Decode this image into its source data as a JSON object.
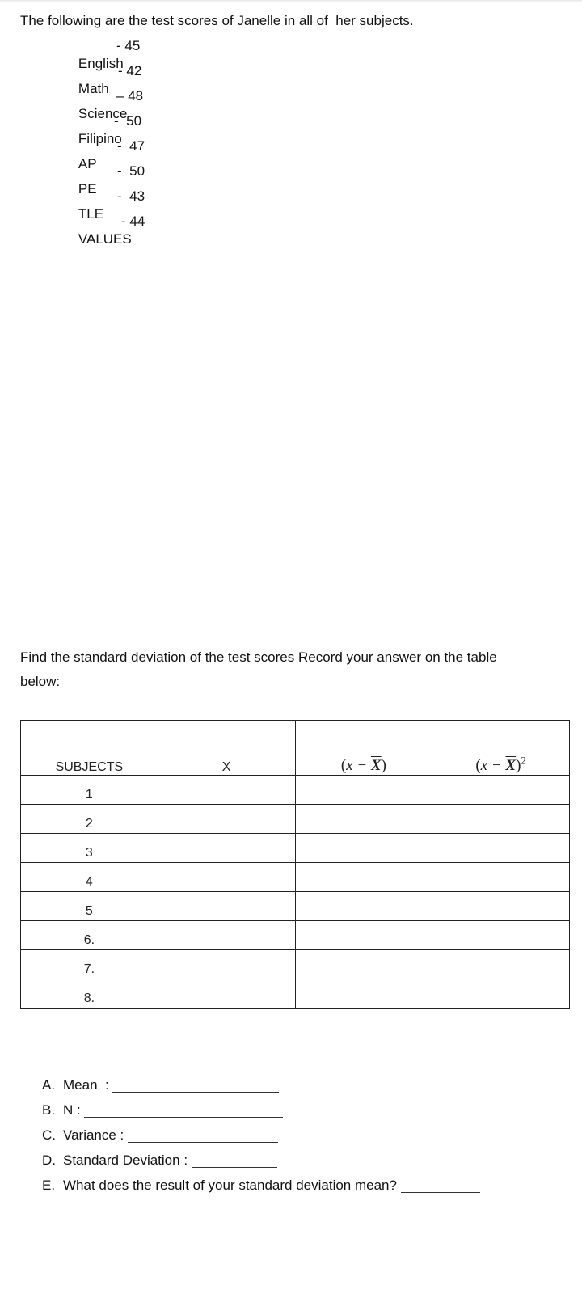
{
  "intro": "The following are the test scores of Janelle in all of  her subjects.",
  "scores": [
    {
      "subject": "English",
      "sep": "-",
      "score": "45"
    },
    {
      "subject": "Math",
      "sep": "-",
      "score": "42"
    },
    {
      "subject": "Science",
      "sep": "–",
      "score": "48"
    },
    {
      "subject": "Filipino",
      "sep": "-",
      "score": "50"
    },
    {
      "subject": "AP",
      "sep": "-",
      "score": "47"
    },
    {
      "subject": "PE",
      "sep": "-",
      "score": "50"
    },
    {
      "subject": "TLE",
      "sep": "-",
      "score": "43"
    },
    {
      "subject": "VALUES",
      "sep": "-",
      "score": "44"
    }
  ],
  "instruction": "Find the standard deviation of the test scores Record your answer on the table below:",
  "table": {
    "headers": {
      "subjects": "SUBJECTS",
      "x": "X",
      "dev_open": "(x − ",
      "dev_bar": "X",
      "dev_close": ")",
      "sq_open": "(x − ",
      "sq_bar": "X",
      "sq_close": ")",
      "sq_exp": "2"
    },
    "rows": [
      "1",
      "2",
      "3",
      "4",
      "5",
      "6.",
      "7.",
      "8."
    ]
  },
  "questions": [
    {
      "letter": "A.",
      "text": "Mean  : "
    },
    {
      "letter": "B.",
      "text": "N : "
    },
    {
      "letter": "C.",
      "text": "Variance : "
    },
    {
      "letter": "D.",
      "text": "Standard Deviation : "
    },
    {
      "letter": "E.",
      "text": "What does the result of your standard deviation mean? "
    }
  ]
}
